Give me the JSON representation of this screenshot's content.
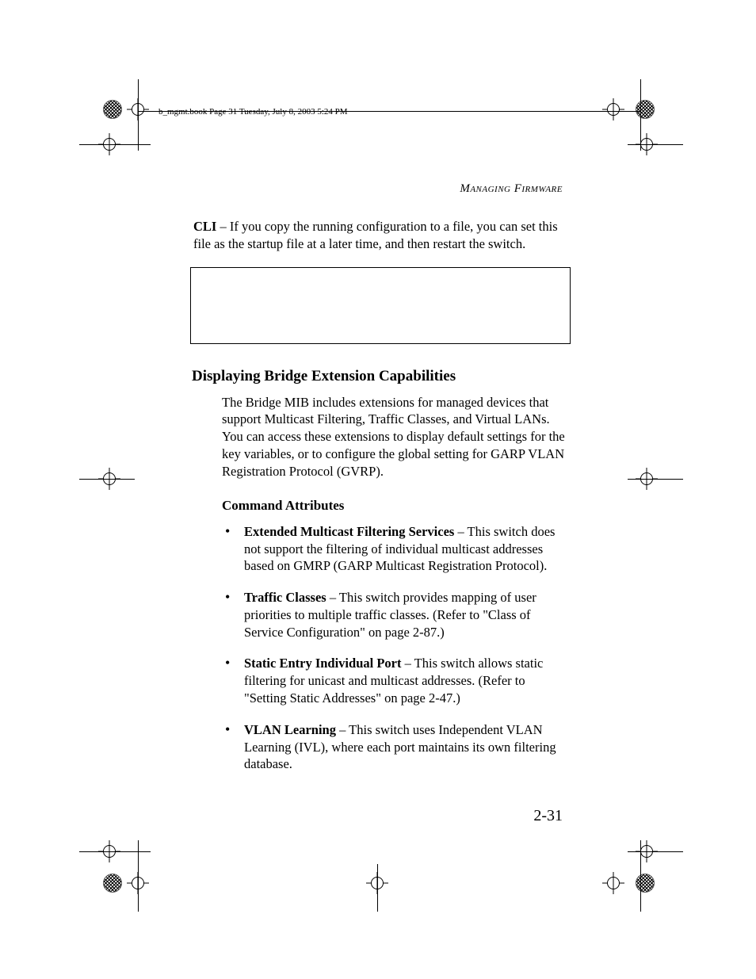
{
  "printmark_note": "b_mgmt.book  Page 31  Tuesday, July 8, 2003  5:24 PM",
  "running_head": "Managing Firmware",
  "intro": {
    "cli_label": "CLI",
    "cli_text": " – If you copy the running configuration to a file, you can set this file as the startup file at a later time, and then restart the switch."
  },
  "section_title": "Displaying Bridge Extension Capabilities",
  "section_intro": "The Bridge MIB includes extensions for managed devices that support Multicast Filtering, Traffic Classes, and Virtual LANs. You can access these extensions to display default settings for the key variables, or to configure the global setting for GARP VLAN Registration Protocol (GVRP).",
  "subhead": "Command Attributes",
  "bullets": [
    {
      "term": "Extended Multicast Filtering Services",
      "desc": " – This switch does not support the filtering of individual multicast addresses based on GMRP (GARP Multicast Registration Protocol)."
    },
    {
      "term": "Traffic Classes",
      "desc": " – This switch provides mapping of user priorities to multiple traffic classes. (Refer to \"Class of Service Configuration\" on page 2-87.)"
    },
    {
      "term": "Static Entry Individual Port",
      "desc": " – This switch allows static filtering for unicast and multicast addresses. (Refer to \"Setting Static Addresses\" on page 2-47.)"
    },
    {
      "term": "VLAN Learning",
      "desc": " – This switch uses Independent VLAN Learning (IVL), where each port maintains its own filtering database."
    }
  ],
  "page_number": "2-31"
}
